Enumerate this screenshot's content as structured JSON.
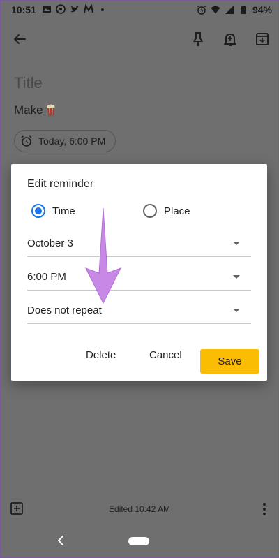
{
  "status_bar": {
    "time": "10:51",
    "battery": "94%",
    "icons_left": [
      "image-icon",
      "whatsapp-icon",
      "twitter-icon",
      "medium-icon",
      "dot-icon"
    ],
    "icons_right": [
      "alarm-icon",
      "wifi-icon",
      "signal-icon",
      "battery-icon"
    ]
  },
  "app_bar": {
    "icons": [
      "back-arrow-icon",
      "pin-icon",
      "reminder-bell-icon",
      "archive-icon"
    ]
  },
  "note": {
    "title_placeholder": "Title",
    "body": "Make",
    "body_emoji_icon": "popcorn-icon",
    "reminder_chip": "Today, 6:00 PM"
  },
  "dialog": {
    "title": "Edit reminder",
    "radio_time": "Time",
    "radio_place": "Place",
    "selected_radio": "Time",
    "date": "October 3",
    "time": "6:00 PM",
    "repeat": "Does not repeat",
    "buttons": {
      "delete": "Delete",
      "cancel": "Cancel",
      "save": "Save"
    },
    "accent_color": "#1a73e8",
    "save_color": "#fbbc04"
  },
  "annotation": {
    "arrow_color": "#c888e6",
    "arrow_icon": "down-arrow-annotation"
  },
  "bottom_bar": {
    "edited": "Edited 10:42 AM",
    "icons": [
      "add-box-icon",
      "more-vert-icon"
    ]
  },
  "nav_bar": {
    "icons": [
      "nav-back-icon",
      "nav-home-pill"
    ]
  }
}
